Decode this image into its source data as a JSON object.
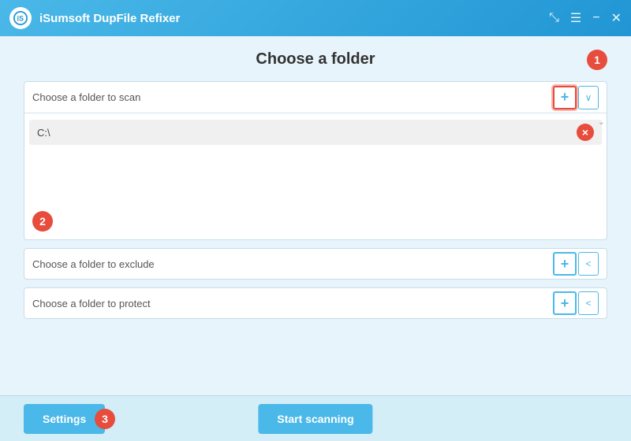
{
  "titlebar": {
    "logo_alt": "iSumsoft logo",
    "title": "iSumsoft DupFile Refixer",
    "share_icon": "share-icon",
    "menu_icon": "menu-icon",
    "minimize_icon": "minimize-icon",
    "close_icon": "close-icon"
  },
  "page": {
    "title": "Choose a folder",
    "step1_badge": "1",
    "step2_badge": "2",
    "step3_badge": "3"
  },
  "scan_panel": {
    "header_label": "Choose a folder to scan",
    "add_btn_label": "+",
    "expand_btn_label": "∨",
    "folders": [
      {
        "path": "C:\\",
        "remove_label": "×"
      }
    ]
  },
  "exclude_panel": {
    "header_label": "Choose a folder to exclude",
    "add_btn_label": "+",
    "collapse_btn_label": "<"
  },
  "protect_panel": {
    "header_label": "Choose a folder to protect",
    "add_btn_label": "+",
    "collapse_btn_label": "<"
  },
  "footer": {
    "settings_btn": "Settings",
    "start_scan_btn": "Start scanning"
  }
}
